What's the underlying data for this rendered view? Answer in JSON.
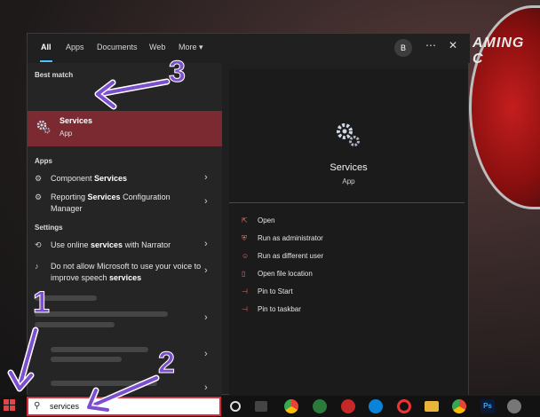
{
  "wallpaper": {
    "badge_text": "AMING C"
  },
  "start": {
    "tabs": [
      {
        "label": "All"
      },
      {
        "label": "Apps"
      },
      {
        "label": "Documents"
      },
      {
        "label": "Web"
      },
      {
        "label": "More"
      }
    ],
    "avatar_initial": "B",
    "more_icon": "more-dots-icon",
    "close_icon": "close-icon",
    "best_match": {
      "section": "Best match",
      "title": "Services",
      "subtitle": "App"
    },
    "apps_section": "Apps",
    "apps": [
      {
        "pre": "Component ",
        "bold": "Services",
        "post": ""
      },
      {
        "pre": "Reporting ",
        "bold": "Services",
        "post": " Configuration Manager"
      }
    ],
    "settings_section": "Settings",
    "settings": [
      {
        "pre": "Use online ",
        "bold": "services",
        "post": " with Narrator"
      },
      {
        "pre": "Do not allow Microsoft to use your voice to improve speech ",
        "bold": "services",
        "post": ""
      }
    ],
    "preview": {
      "title": "Services",
      "subtitle": "App",
      "actions": [
        {
          "label": "Open",
          "icon": "open-icon"
        },
        {
          "label": "Run as administrator",
          "icon": "shield-icon"
        },
        {
          "label": "Run as different user",
          "icon": "user-icon"
        },
        {
          "label": "Open file location",
          "icon": "folder-icon"
        },
        {
          "label": "Pin to Start",
          "icon": "pin-icon"
        },
        {
          "label": "Pin to taskbar",
          "icon": "pin-icon"
        }
      ]
    }
  },
  "taskbar": {
    "search_value": "services",
    "icons": [
      "cortana-icon",
      "task-view-icon",
      "chrome-icon",
      "edge-icon",
      "opera-icon",
      "file-explorer-icon",
      "photoshop-icon"
    ],
    "photoshop_label": "Ps"
  },
  "annotations": [
    "1",
    "2",
    "3"
  ],
  "colors": {
    "accent": "#4cc2ff",
    "highlight": "#7a2a30",
    "arrow": "#7c4fcf",
    "search_border": "#d62f3b"
  }
}
